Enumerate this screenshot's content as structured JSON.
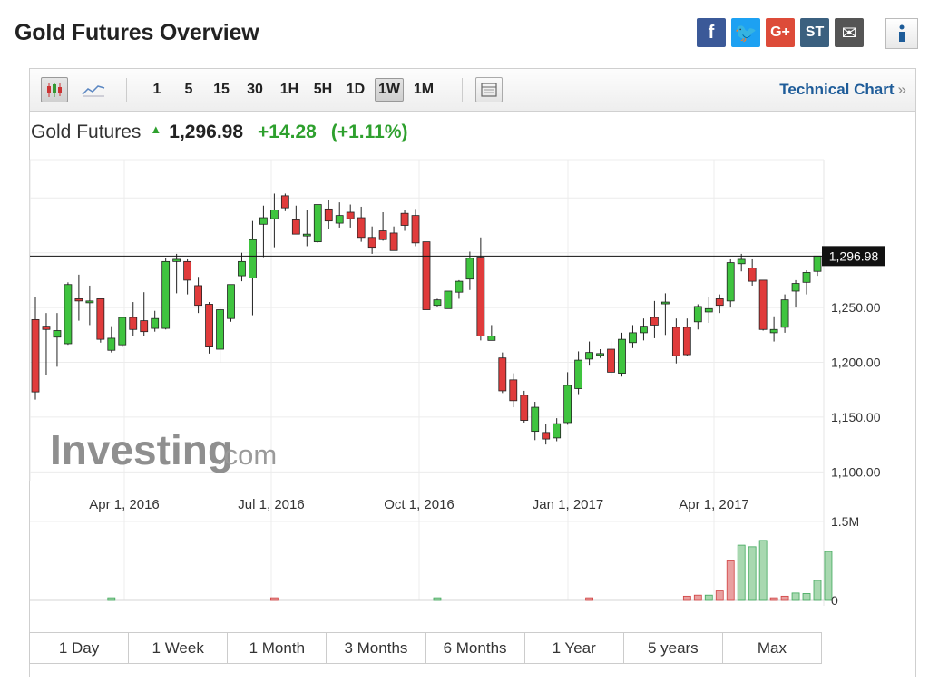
{
  "page": {
    "title": "Gold Futures Overview"
  },
  "social": [
    {
      "name": "facebook-icon",
      "glyph": "f",
      "cls": "fb"
    },
    {
      "name": "twitter-icon",
      "glyph": "🐦",
      "cls": "tw"
    },
    {
      "name": "google-plus-icon",
      "glyph": "G+",
      "cls": "gp"
    },
    {
      "name": "stocktwits-icon",
      "glyph": "ST",
      "cls": "st"
    },
    {
      "name": "email-icon",
      "glyph": "✉",
      "cls": "em"
    }
  ],
  "toolbar": {
    "intervals": [
      "1",
      "5",
      "15",
      "30",
      "1H",
      "5H",
      "1D",
      "1W",
      "1M"
    ],
    "active_interval": "1W",
    "technical_chart_label": "Technical Chart",
    "technical_chart_arrow": "»"
  },
  "quote": {
    "name": "Gold Futures",
    "price": "1,296.98",
    "change": "+14.28",
    "change_pct": "(+1.11%)",
    "direction": "up"
  },
  "watermark": {
    "brand": "Investing",
    "suffix": ".com"
  },
  "ranges": [
    "1 Day",
    "1 Week",
    "1 Month",
    "3 Months",
    "6 Months",
    "1 Year",
    "5 years",
    "Max"
  ],
  "chart_data": {
    "type": "candlestick",
    "x_tick_labels": [
      "Apr 1, 2016",
      "Jul 1, 2016",
      "Oct 1, 2016",
      "Jan 1, 2017",
      "Apr 1, 2017"
    ],
    "y_tick_labels": [
      "1,250.00",
      "1,200.00",
      "1,150.00",
      "1,100.00"
    ],
    "y_ticks": [
      1250,
      1200,
      1150,
      1100
    ],
    "ylim": [
      1092,
      1385
    ],
    "last_price": 1296.98,
    "last_price_label": "1,296.98",
    "volume_axis_labels": [
      "1.5M",
      "0"
    ],
    "volume_max": 1500000,
    "up_color": "#3fc43f",
    "down_color": "#e03b3b",
    "candles": [
      [
        1239,
        1173,
        1260,
        1166
      ],
      [
        1233,
        1230,
        1245,
        1188
      ],
      [
        1223,
        1229,
        1245,
        1196
      ],
      [
        1217,
        1271,
        1273,
        1216
      ],
      [
        1258,
        1256,
        1280,
        1238
      ],
      [
        1256,
        1256,
        1270,
        1234
      ],
      [
        1258,
        1221,
        1258,
        1218
      ],
      [
        1211,
        1222,
        1233,
        1209
      ],
      [
        1216,
        1241,
        1240,
        1214
      ],
      [
        1241,
        1230,
        1255,
        1224
      ],
      [
        1238,
        1228,
        1264,
        1224
      ],
      [
        1231,
        1240,
        1247,
        1228
      ],
      [
        1231,
        1292,
        1295,
        1230
      ],
      [
        1292,
        1294,
        1299,
        1263
      ],
      [
        1292,
        1275,
        1294,
        1262
      ],
      [
        1270,
        1252,
        1278,
        1245
      ],
      [
        1253,
        1214,
        1255,
        1208
      ],
      [
        1212,
        1248,
        1250,
        1200
      ],
      [
        1240,
        1271,
        1270,
        1237
      ],
      [
        1279,
        1292,
        1300,
        1274
      ],
      [
        1277,
        1312,
        1329,
        1243
      ],
      [
        1326,
        1332,
        1343,
        1296
      ],
      [
        1331,
        1339,
        1354,
        1305
      ],
      [
        1352,
        1341,
        1354,
        1338
      ],
      [
        1330,
        1317,
        1343,
        1317
      ],
      [
        1317,
        1317,
        1339,
        1306
      ],
      [
        1310,
        1344,
        1342,
        1309
      ],
      [
        1340,
        1329,
        1348,
        1322
      ],
      [
        1327,
        1334,
        1346,
        1323
      ],
      [
        1337,
        1331,
        1344,
        1323
      ],
      [
        1332,
        1314,
        1342,
        1310
      ],
      [
        1314,
        1305,
        1324,
        1299
      ],
      [
        1320,
        1312,
        1337,
        1311
      ],
      [
        1318,
        1302,
        1324,
        1302
      ],
      [
        1336,
        1325,
        1339,
        1320
      ],
      [
        1334,
        1309,
        1340,
        1306
      ],
      [
        1310,
        1248,
        1305,
        1249
      ],
      [
        1252,
        1257,
        1258,
        1251
      ],
      [
        1249,
        1265,
        1262,
        1249
      ],
      [
        1264,
        1274,
        1275,
        1258
      ],
      [
        1276,
        1295,
        1301,
        1266
      ],
      [
        1296,
        1224,
        1314,
        1220
      ],
      [
        1220,
        1224,
        1234,
        1220
      ],
      [
        1204,
        1174,
        1209,
        1172
      ],
      [
        1184,
        1165,
        1190,
        1159
      ],
      [
        1170,
        1147,
        1174,
        1145
      ],
      [
        1137,
        1159,
        1164,
        1129
      ],
      [
        1136,
        1130,
        1144,
        1125
      ],
      [
        1131,
        1144,
        1149,
        1128
      ],
      [
        1145,
        1179,
        1191,
        1143
      ],
      [
        1176,
        1202,
        1210,
        1171
      ],
      [
        1203,
        1209,
        1219,
        1197
      ],
      [
        1208,
        1208,
        1212,
        1204
      ],
      [
        1212,
        1191,
        1219,
        1187
      ],
      [
        1190,
        1221,
        1227,
        1187
      ],
      [
        1218,
        1227,
        1234,
        1213
      ],
      [
        1227,
        1233,
        1240,
        1220
      ],
      [
        1241,
        1234,
        1256,
        1222
      ],
      [
        1255,
        1255,
        1263,
        1225
      ],
      [
        1232,
        1206,
        1240,
        1199
      ],
      [
        1232,
        1207,
        1240,
        1206
      ],
      [
        1237,
        1251,
        1253,
        1230
      ],
      [
        1246,
        1249,
        1260,
        1236
      ],
      [
        1258,
        1252,
        1262,
        1245
      ],
      [
        1256,
        1291,
        1294,
        1250
      ],
      [
        1290,
        1294,
        1299,
        1283
      ],
      [
        1286,
        1274,
        1294,
        1270
      ],
      [
        1275,
        1230,
        1275,
        1229
      ],
      [
        1227,
        1230,
        1242,
        1219
      ],
      [
        1232,
        1257,
        1262,
        1227
      ],
      [
        1265,
        1272,
        1275,
        1250
      ],
      [
        1273,
        1282,
        1284,
        1262
      ],
      [
        1283,
        1297,
        1296,
        1279
      ]
    ],
    "volume_bars": [
      [
        7,
        0.05,
        "up"
      ],
      [
        22,
        0.05,
        "down"
      ],
      [
        37,
        0.05,
        "up"
      ],
      [
        51,
        0.05,
        "down"
      ],
      [
        60,
        0.08,
        "down"
      ],
      [
        61,
        0.1,
        "down"
      ],
      [
        62,
        0.1,
        "up"
      ],
      [
        63,
        0.18,
        "down"
      ],
      [
        64,
        0.75,
        "down"
      ],
      [
        65,
        1.05,
        "up"
      ],
      [
        66,
        1.02,
        "up"
      ],
      [
        67,
        1.14,
        "up"
      ],
      [
        68,
        0.05,
        "down"
      ],
      [
        69,
        0.08,
        "down"
      ],
      [
        70,
        0.14,
        "up"
      ],
      [
        71,
        0.13,
        "up"
      ],
      [
        72,
        0.38,
        "up"
      ],
      [
        73,
        0.93,
        "up"
      ]
    ]
  }
}
